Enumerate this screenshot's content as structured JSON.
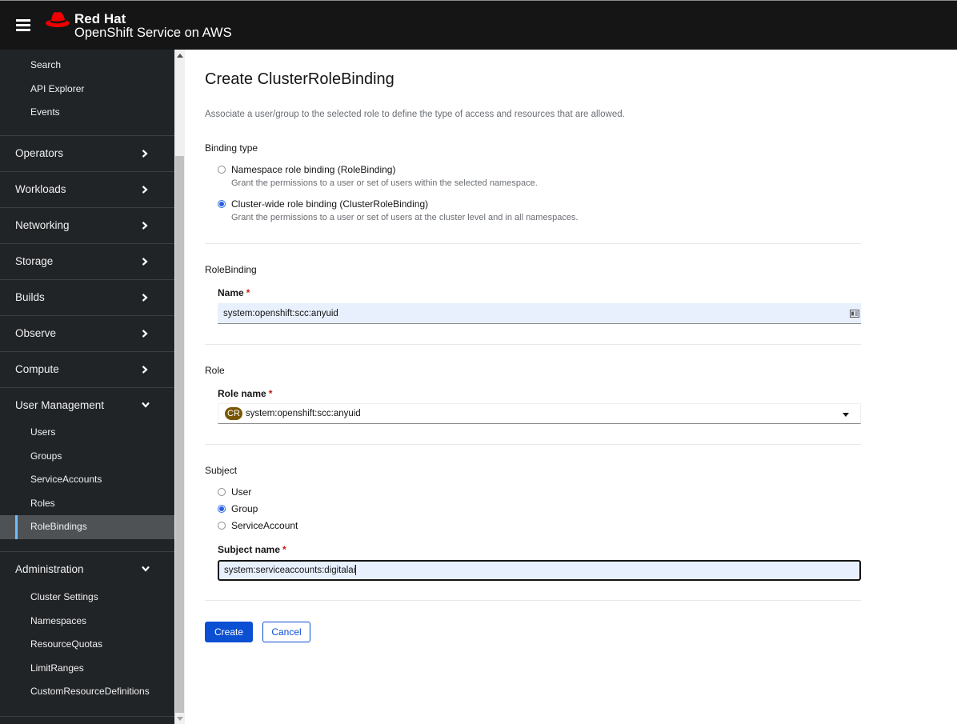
{
  "masthead": {
    "brand_line1": "Red Hat",
    "brand_line2_bold": "OpenShift",
    "brand_line2_rest": " Service on AWS"
  },
  "sidebar": {
    "top_items": [
      "Search",
      "API Explorer",
      "Events"
    ],
    "groups": [
      {
        "label": "Operators",
        "expanded": false
      },
      {
        "label": "Workloads",
        "expanded": false
      },
      {
        "label": "Networking",
        "expanded": false
      },
      {
        "label": "Storage",
        "expanded": false
      },
      {
        "label": "Builds",
        "expanded": false
      },
      {
        "label": "Observe",
        "expanded": false
      },
      {
        "label": "Compute",
        "expanded": false
      },
      {
        "label": "User Management",
        "expanded": true,
        "items": [
          "Users",
          "Groups",
          "ServiceAccounts",
          "Roles",
          "RoleBindings"
        ],
        "active": "RoleBindings"
      },
      {
        "label": "Administration",
        "expanded": true,
        "items": [
          "Cluster Settings",
          "Namespaces",
          "ResourceQuotas",
          "LimitRanges",
          "CustomResourceDefinitions"
        ]
      }
    ]
  },
  "page": {
    "title": "Create ClusterRoleBinding",
    "description": "Associate a user/group to the selected role to define the type of access and resources that are allowed.",
    "binding_type": {
      "label": "Binding type",
      "options": [
        {
          "label": "Namespace role binding (RoleBinding)",
          "help": "Grant the permissions to a user or set of users within the selected namespace.",
          "checked": false
        },
        {
          "label": "Cluster-wide role binding (ClusterRoleBinding)",
          "help": "Grant the permissions to a user or set of users at the cluster level and in all namespaces.",
          "checked": true
        }
      ]
    },
    "rolebinding": {
      "section_label": "RoleBinding",
      "name_label": "Name",
      "required_marker": "*",
      "name_value": "system:openshift:scc:anyuid"
    },
    "role": {
      "section_label": "Role",
      "role_name_label": "Role name",
      "required_marker": "*",
      "badge": "CR",
      "role_name_value": "system:openshift:scc:anyuid"
    },
    "subject": {
      "section_label": "Subject",
      "options": [
        {
          "label": "User",
          "checked": false
        },
        {
          "label": "Group",
          "checked": true
        },
        {
          "label": "ServiceAccount",
          "checked": false
        }
      ],
      "subject_name_label": "Subject name",
      "required_marker": "*",
      "subject_name_value": "system:serviceaccounts:digitalai"
    },
    "buttons": {
      "create": "Create",
      "cancel": "Cancel"
    }
  },
  "colors": {
    "masthead_bg": "#151515",
    "sidebar_bg": "#212427",
    "active_nav_bg": "#4f5255",
    "active_nav_accent": "#73bcf7",
    "primary_button": "#0b4fd2",
    "required": "#c9190b",
    "cr_badge": "#795600"
  }
}
